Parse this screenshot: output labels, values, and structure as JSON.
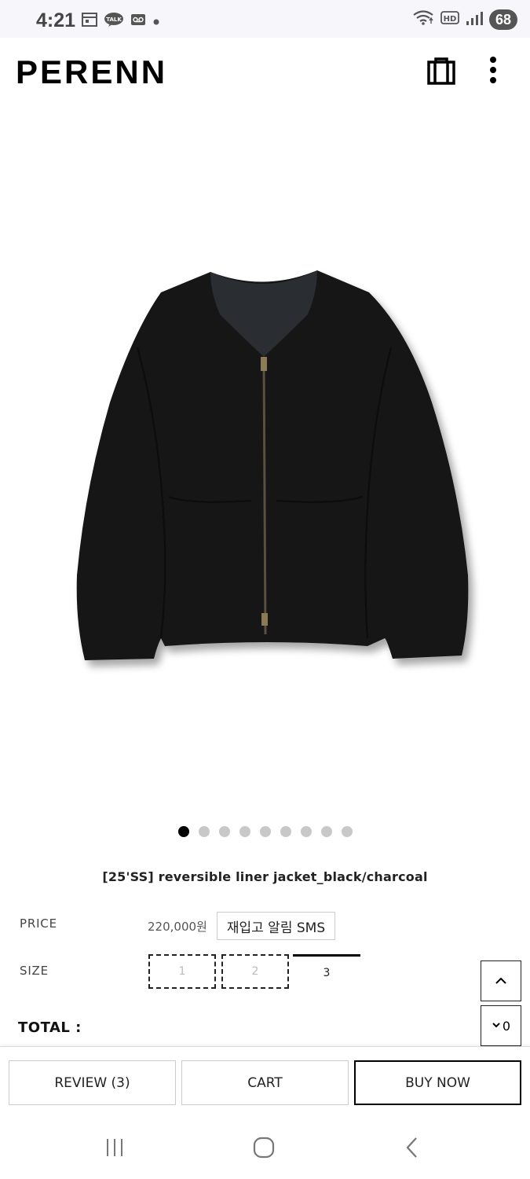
{
  "status_bar": {
    "time": "4:21",
    "battery": "68",
    "notification_icons": [
      "calendar-icon",
      "kakaotalk-icon",
      "voicemail-icon",
      "dot-icon"
    ],
    "system_icons": [
      "wifi-icon",
      "hd-voice-icon",
      "signal-icon"
    ]
  },
  "header": {
    "logo": "PERENN",
    "cart_icon": "shopping-bag-icon",
    "menu_icon": "more-vertical-icon"
  },
  "carousel": {
    "total": 9,
    "active_index": 0
  },
  "product": {
    "title": "[25'SS] reversible liner jacket_black/charcoal",
    "price_label": "PRICE",
    "price": "220,000원",
    "restock_button": "재입고 알림 SMS",
    "size_label": "SIZE",
    "sizes": [
      {
        "label": "1",
        "status": "soldout"
      },
      {
        "label": "2",
        "status": "soldout"
      },
      {
        "label": "3",
        "status": "available"
      }
    ],
    "total_label": "TOTAL :"
  },
  "scroll_buttons": {
    "up": "chevron-up-icon",
    "down": "chevron-down-icon",
    "down_suffix": "0"
  },
  "actions": {
    "review": "REVIEW (3)",
    "cart": "CART",
    "buy": "BUY NOW"
  },
  "system_nav": {
    "recents": "recents-icon",
    "home": "home-icon",
    "back": "back-icon"
  }
}
